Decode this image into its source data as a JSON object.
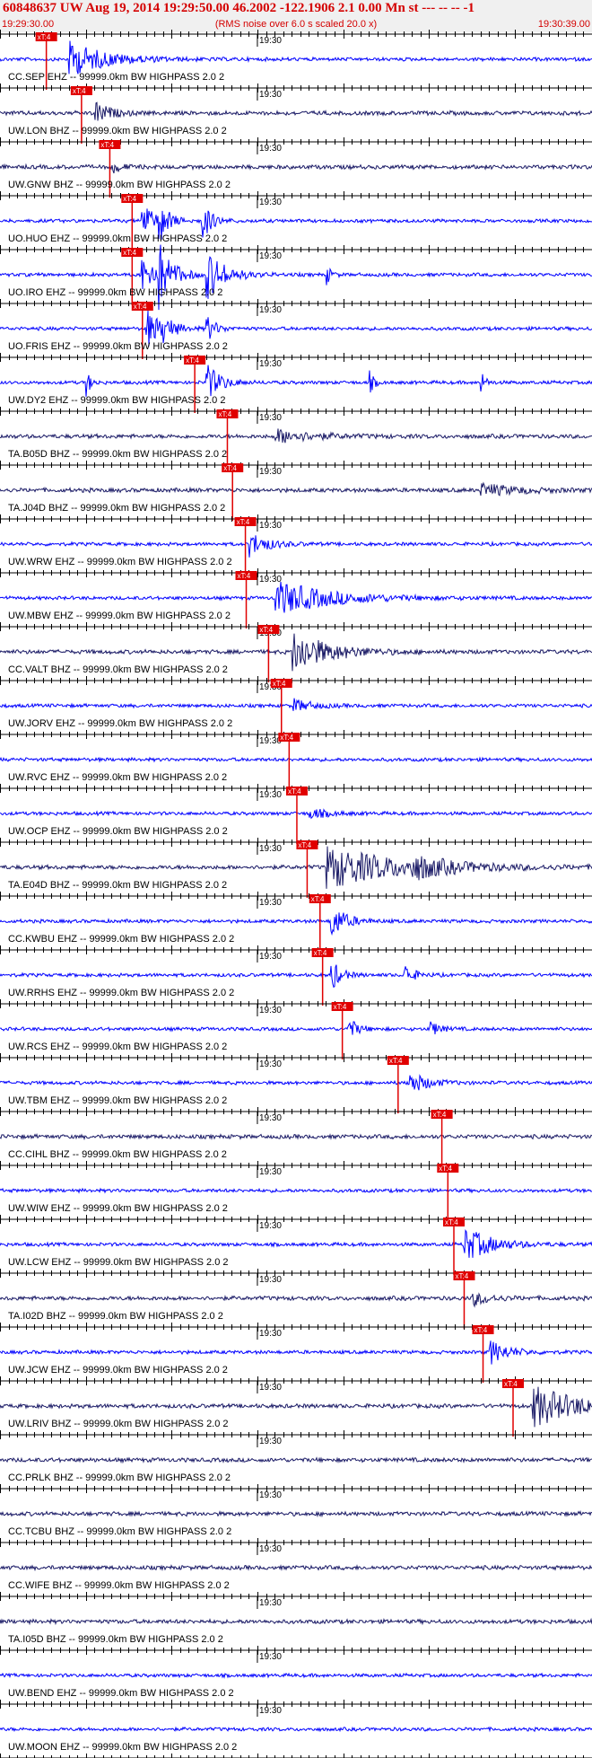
{
  "header": {
    "title": "60848637 UW Aug 19, 2014 19:29:50.00   46.2002 -122.1906  2.1 0.00 Mn st --- -- --   -1",
    "start_time": "19:29:30.00",
    "end_time": "19:30:39.00",
    "subtitle": "(RMS noise over 6.0 s scaled 20.0 x)"
  },
  "colors": {
    "header_red": "#d40000",
    "pick_red": "#e00000",
    "blue": "#0000ff",
    "navy": "#1a1a66",
    "axis": "#000000",
    "header_bg": "#f0f0f0"
  },
  "chart_data": {
    "type": "line",
    "description_units": "seismogram traces; x = time (seconds after 19:29:30), pick_time = P arrival mark",
    "x_range": [
      0,
      69
    ],
    "axis_tick_label": "19:30",
    "axis_tick_label_time": 30,
    "pick_label": "xT:4",
    "series": [
      {
        "label": "CC.SEP EHZ -- 99999.0km BW  HIGHPASS  2.0  2",
        "color": "blue",
        "pick_time": 5.4,
        "events": [
          {
            "t": 8,
            "a": 20,
            "d": 4
          }
        ]
      },
      {
        "label": "UW.LON BHZ -- 99999.0km BW  HIGHPASS  2.0  2",
        "color": "navy",
        "pick_time": 9.5,
        "events": [
          {
            "t": 11,
            "a": 14,
            "d": 1.5
          }
        ]
      },
      {
        "label": "UW.GNW BHZ -- 99999.0km BW  HIGHPASS  2.0  2",
        "color": "navy",
        "pick_time": 12.8,
        "events": [
          {
            "t": 13,
            "a": 8,
            "d": 1
          }
        ]
      },
      {
        "label": "UO.HUO EHZ -- 99999.0km BW  HIGHPASS  2.0  2",
        "color": "blue",
        "pick_time": 15.4,
        "events": [
          {
            "t": 16.5,
            "a": 30,
            "d": 1
          },
          {
            "t": 18.5,
            "a": 26,
            "d": 1
          },
          {
            "t": 23.5,
            "a": 24,
            "d": 1
          }
        ]
      },
      {
        "label": "UO.IRO EHZ -- 99999.0km BW  HIGHPASS  2.0  2",
        "color": "blue",
        "pick_time": 15.4,
        "events": [
          {
            "t": 16.5,
            "a": 30,
            "d": 1.5
          },
          {
            "t": 18.5,
            "a": 30,
            "d": 1.5
          },
          {
            "t": 24,
            "a": 28,
            "d": 2
          },
          {
            "t": 38,
            "a": 12,
            "d": 0.5
          }
        ]
      },
      {
        "label": "UO.FRIS EHZ -- 99999.0km BW  HIGHPASS  2.0  2",
        "color": "blue",
        "pick_time": 16.6,
        "events": [
          {
            "t": 17,
            "a": 24,
            "d": 1.5
          },
          {
            "t": 19,
            "a": 14,
            "d": 1
          },
          {
            "t": 24,
            "a": 16,
            "d": 1
          }
        ]
      },
      {
        "label": "UW.DY2 EHZ -- 99999.0km BW  HIGHPASS  2.0  2",
        "color": "blue",
        "pick_time": 22.7,
        "events": [
          {
            "t": 10,
            "a": 16,
            "d": 0.5
          },
          {
            "t": 24,
            "a": 22,
            "d": 1.5
          },
          {
            "t": 43,
            "a": 14,
            "d": 0.5
          },
          {
            "t": 56,
            "a": 14,
            "d": 0.5
          }
        ]
      },
      {
        "label": "TA.B05D BHZ -- 99999.0km BW  HIGHPASS  2.0  2",
        "color": "navy",
        "pick_time": 26.5,
        "events": [
          {
            "t": 32,
            "a": 8,
            "d": 4
          }
        ]
      },
      {
        "label": "TA.J04D BHZ -- 99999.0km BW  HIGHPASS  2.0  2",
        "color": "navy",
        "pick_time": 27.1,
        "events": [
          {
            "t": 56,
            "a": 7,
            "d": 4
          }
        ]
      },
      {
        "label": "UW.WRW EHZ -- 99999.0km BW  HIGHPASS  2.0  2",
        "color": "blue",
        "pick_time": 28.6,
        "events": [
          {
            "t": 29,
            "a": 14,
            "d": 2
          }
        ]
      },
      {
        "label": "UW.MBW EHZ -- 99999.0km BW  HIGHPASS  2.0  2",
        "color": "blue",
        "pick_time": 28.7,
        "events": [
          {
            "t": 32,
            "a": 20,
            "d": 6
          }
        ]
      },
      {
        "label": "CC.VALT BHZ -- 99999.0km BW  HIGHPASS  2.0  2",
        "color": "navy",
        "pick_time": 31.3,
        "events": [
          {
            "t": 34,
            "a": 24,
            "d": 4
          }
        ]
      },
      {
        "label": "UW.JORV EHZ -- 99999.0km BW  HIGHPASS  2.0  2",
        "color": "blue",
        "pick_time": 32.8,
        "events": [
          {
            "t": 34,
            "a": 8,
            "d": 2
          }
        ]
      },
      {
        "label": "UW.RVC EHZ -- 99999.0km BW  HIGHPASS  2.0  2",
        "color": "blue",
        "pick_time": 33.7,
        "events": []
      },
      {
        "label": "UW.OCP EHZ -- 99999.0km BW  HIGHPASS  2.0  2",
        "color": "blue",
        "pick_time": 34.6,
        "events": [
          {
            "t": 36,
            "a": 6,
            "d": 2
          }
        ]
      },
      {
        "label": "TA.E04D BHZ -- 99999.0km BW  HIGHPASS  2.0  2",
        "color": "navy",
        "pick_time": 35.8,
        "events": [
          {
            "t": 38,
            "a": 24,
            "d": 8
          },
          {
            "t": 48,
            "a": 10,
            "d": 3
          }
        ]
      },
      {
        "label": "CC.KWBU EHZ -- 99999.0km BW  HIGHPASS  2.0  2",
        "color": "blue",
        "pick_time": 37.3,
        "events": [
          {
            "t": 38.5,
            "a": 22,
            "d": 1.5
          }
        ]
      },
      {
        "label": "UW.RRHS EHZ -- 99999.0km BW  HIGHPASS  2.0  2",
        "color": "blue",
        "pick_time": 37.6,
        "events": [
          {
            "t": 38.5,
            "a": 20,
            "d": 1
          },
          {
            "t": 47,
            "a": 14,
            "d": 1
          }
        ]
      },
      {
        "label": "UW.RCS EHZ -- 99999.0km BW  HIGHPASS  2.0  2",
        "color": "blue",
        "pick_time": 39.9,
        "events": [
          {
            "t": 40.5,
            "a": 14,
            "d": 1
          },
          {
            "t": 50,
            "a": 10,
            "d": 1
          }
        ]
      },
      {
        "label": "UW.TBM EHZ -- 99999.0km BW  HIGHPASS  2.0  2",
        "color": "blue",
        "pick_time": 46.4,
        "events": [
          {
            "t": 47.5,
            "a": 14,
            "d": 2
          }
        ]
      },
      {
        "label": "CC.CIHL BHZ -- 99999.0km BW  HIGHPASS  2.0  2",
        "color": "navy",
        "pick_time": 51.5,
        "events": []
      },
      {
        "label": "UW.WIW EHZ -- 99999.0km BW  HIGHPASS  2.0  2",
        "color": "blue",
        "pick_time": 52.2,
        "events": []
      },
      {
        "label": "UW.LCW EHZ -- 99999.0km BW  HIGHPASS  2.0  2",
        "color": "blue",
        "pick_time": 52.9,
        "events": [
          {
            "t": 54,
            "a": 20,
            "d": 3
          }
        ]
      },
      {
        "label": "TA.I02D BHZ -- 99999.0km BW  HIGHPASS  2.0  2",
        "color": "navy",
        "pick_time": 54.1,
        "events": [
          {
            "t": 55,
            "a": 8,
            "d": 2
          }
        ]
      },
      {
        "label": "UW.JCW EHZ -- 99999.0km BW  HIGHPASS  2.0  2",
        "color": "blue",
        "pick_time": 56.3,
        "events": [
          {
            "t": 57,
            "a": 14,
            "d": 2
          }
        ]
      },
      {
        "label": "UW.LRIV BHZ -- 99999.0km BW  HIGHPASS  2.0  2",
        "color": "navy",
        "pick_time": 59.8,
        "events": [
          {
            "t": 62,
            "a": 24,
            "d": 5
          }
        ]
      },
      {
        "label": "CC.PRLK BHZ -- 99999.0km BW  HIGHPASS  2.0  2",
        "color": "navy",
        "pick_time": null,
        "events": []
      },
      {
        "label": "CC.TCBU BHZ -- 99999.0km BW  HIGHPASS  2.0  2",
        "color": "navy",
        "pick_time": null,
        "events": []
      },
      {
        "label": "CC.WIFE BHZ -- 99999.0km BW  HIGHPASS  2.0  2",
        "color": "navy",
        "pick_time": null,
        "events": []
      },
      {
        "label": "TA.I05D BHZ -- 99999.0km BW  HIGHPASS  2.0  2",
        "color": "navy",
        "pick_time": null,
        "events": []
      },
      {
        "label": "UW.BEND EHZ -- 99999.0km BW  HIGHPASS  2.0  2",
        "color": "blue",
        "pick_time": null,
        "events": []
      },
      {
        "label": "UW.MOON EHZ -- 99999.0km BW  HIGHPASS  2.0  2",
        "color": "blue",
        "pick_time": null,
        "events": []
      },
      {
        "label": "",
        "color": "blue",
        "pick_time": null,
        "events": []
      }
    ]
  }
}
